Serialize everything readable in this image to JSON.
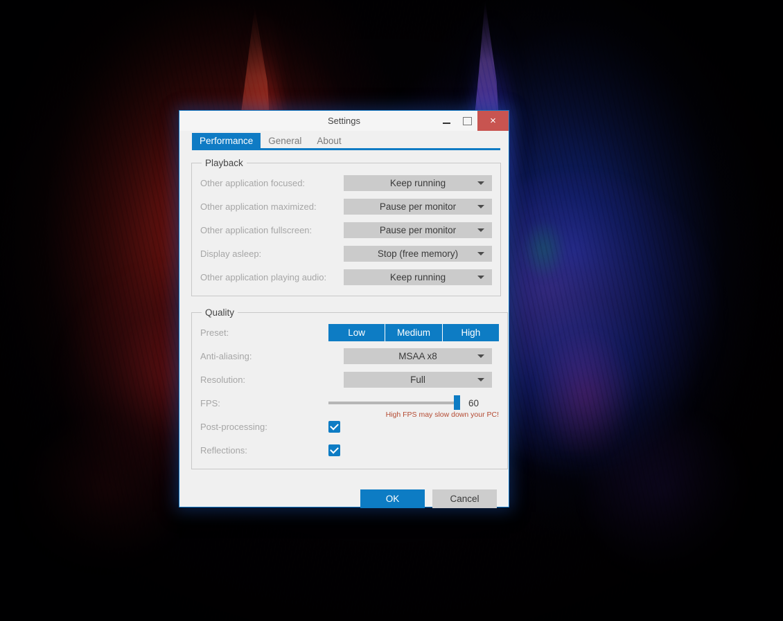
{
  "window": {
    "title": "Settings",
    "controls": {
      "minimize": "–",
      "maximize": "□",
      "close": "×"
    }
  },
  "tabs": [
    {
      "label": "Performance",
      "active": true
    },
    {
      "label": "General",
      "active": false
    },
    {
      "label": "About",
      "active": false
    }
  ],
  "playback": {
    "legend": "Playback",
    "rows": [
      {
        "label": "Other application focused:",
        "value": "Keep running"
      },
      {
        "label": "Other application maximized:",
        "value": "Pause per monitor"
      },
      {
        "label": "Other application fullscreen:",
        "value": "Pause per monitor"
      },
      {
        "label": "Display asleep:",
        "value": "Stop (free memory)"
      },
      {
        "label": "Other application playing audio:",
        "value": "Keep running"
      }
    ]
  },
  "quality": {
    "legend": "Quality",
    "preset": {
      "label": "Preset:",
      "options": [
        "Low",
        "Medium",
        "High"
      ],
      "selected": "High"
    },
    "antialiasing": {
      "label": "Anti-aliasing:",
      "value": "MSAA x8"
    },
    "resolution": {
      "label": "Resolution:",
      "value": "Full"
    },
    "fps": {
      "label": "FPS:",
      "value": "60",
      "percent": 100,
      "warning": "High FPS may slow down your PC!"
    },
    "post_processing": {
      "label": "Post-processing:",
      "checked": true
    },
    "reflections": {
      "label": "Reflections:",
      "checked": true
    }
  },
  "footer": {
    "ok_label": "OK",
    "cancel_label": "Cancel"
  },
  "colors": {
    "accent": "#0d7cc4",
    "close_red": "#c85450",
    "warning": "#b44a32",
    "dialog_bg": "#f0f0f0",
    "combo_bg": "#cbcbcb",
    "label_gray": "#a6a6a6"
  }
}
